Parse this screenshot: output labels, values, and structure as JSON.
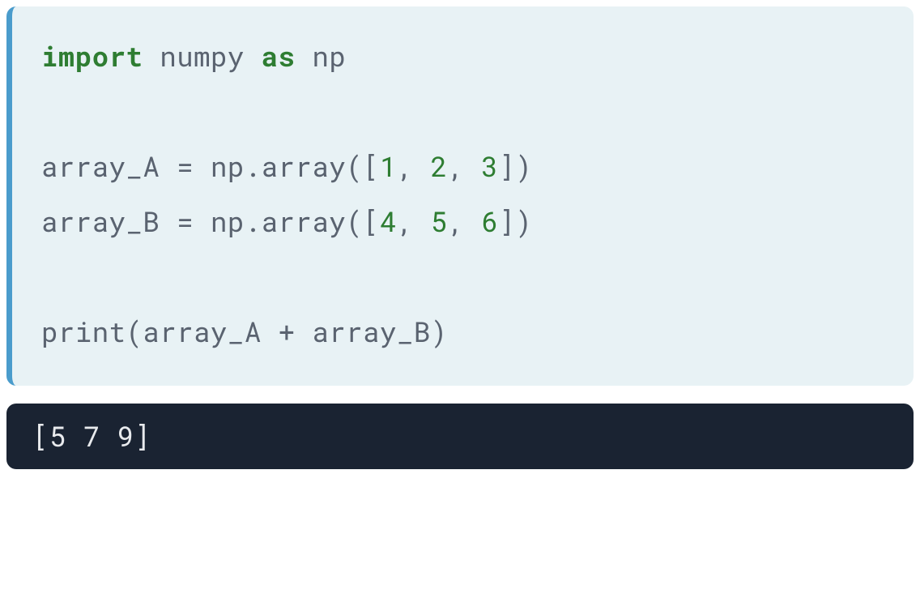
{
  "code": {
    "line1": {
      "kw_import": "import",
      "sp1": " ",
      "module": "numpy",
      "sp2": " ",
      "kw_as": "as",
      "sp3": " ",
      "alias": "np"
    },
    "line3": {
      "prefix": "array_A = np.array([",
      "n1": "1",
      "c1": ", ",
      "n2": "2",
      "c2": ", ",
      "n3": "3",
      "suffix": "])"
    },
    "line4": {
      "prefix": "array_B = np.array([",
      "n1": "4",
      "c1": ", ",
      "n2": "5",
      "c2": ", ",
      "n3": "6",
      "suffix": "])"
    },
    "line6": "print(array_A + array_B)"
  },
  "output": {
    "line1": "[5 7 9]"
  },
  "colors": {
    "code_bg": "#e8f2f5",
    "code_border": "#4a9ccc",
    "code_text": "#5a6370",
    "keyword": "#2e7d32",
    "number": "#2e7d32",
    "output_bg": "#1a2332",
    "output_text": "#e8eaed"
  }
}
